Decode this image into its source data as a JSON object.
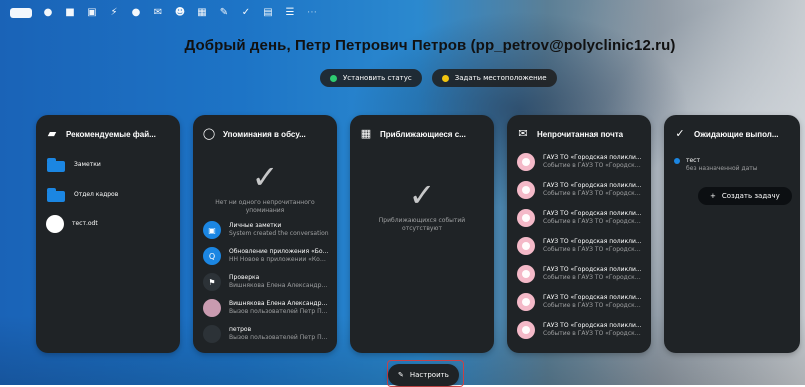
{
  "greeting": "Добрый день, Петр Петрович Петров (pp_petrov@polyclinic12.ru)",
  "actions": {
    "status_label": "Установить статус",
    "location_label": "Задать местоположение"
  },
  "colors": {
    "status_dot": "#2ecc71",
    "location_dot": "#f1c40f",
    "accent": "#1b86e2",
    "card_bg": "#1f2326"
  },
  "topbar": {
    "icons": [
      "logo",
      "dashboard-icon",
      "files-icon",
      "photos-icon",
      "activity-icon",
      "talk-icon",
      "mail-icon",
      "contacts-icon",
      "calendar-icon",
      "notes-icon",
      "tasks-icon",
      "deck-icon",
      "forms-icon",
      "more-icon"
    ]
  },
  "cards": {
    "recommended": {
      "title": "Рекомендуемые фай...",
      "icon": "folder-icon",
      "items": [
        {
          "label": "Заметки",
          "icon": "folder-icon"
        },
        {
          "label": "Отдел кадров",
          "icon": "folder-icon"
        },
        {
          "label": "тест.odt",
          "icon": "file-icon"
        }
      ]
    },
    "mentions": {
      "title": "Упоминания в обсу...",
      "empty_text": "Нет ни одного непрочитанного упоминания",
      "items": [
        {
          "title": "Личные заметки",
          "subtitle": "System created the conversation",
          "avatar_color": "#1b86e2",
          "avatar_text": "▣"
        },
        {
          "title": "Обновление приложения «Бо...",
          "subtitle": "НН Новое в приложении «Кон...",
          "avatar_color": "#1b86e2",
          "avatar_text": "Q"
        },
        {
          "title": "Проверка",
          "subtitle": "Вишнякова Елена Александро...",
          "avatar_color": "#2c3237",
          "avatar_text": "⚑"
        },
        {
          "title": "Вишнякова Елена Александро...",
          "subtitle": "Вызов пользователей Петр П...",
          "avatar_color": "#c99bb0",
          "avatar_text": ""
        },
        {
          "title": "петров",
          "subtitle": "Вызов пользователей Петр П...",
          "avatar_color": "#2c3237",
          "avatar_text": ""
        }
      ]
    },
    "upcoming": {
      "title": "Приближающиеся с...",
      "empty_text": "Приближающихся событий отсутствуют"
    },
    "mail": {
      "title": "Непрочитанная почта",
      "items": [
        {
          "from": "ГАУЗ ТО «Городская поликли...",
          "subject": "Событие в ГАУЗ ТО «Городска..."
        },
        {
          "from": "ГАУЗ ТО «Городская поликли...",
          "subject": "Событие в ГАУЗ ТО «Городска..."
        },
        {
          "from": "ГАУЗ ТО «Городская поликли...",
          "subject": "Событие в ГАУЗ ТО «Городска..."
        },
        {
          "from": "ГАУЗ ТО «Городская поликли...",
          "subject": "Событие в ГАУЗ ТО «Городска..."
        },
        {
          "from": "ГАУЗ ТО «Городская поликли...",
          "subject": "Событие в ГАУЗ ТО «Городска..."
        },
        {
          "from": "ГАУЗ ТО «Городская поликли...",
          "subject": "Событие в ГАУЗ ТО «Городска..."
        },
        {
          "from": "ГАУЗ ТО «Городская поликли...",
          "subject": "Событие в ГАУЗ ТО «Городска..."
        }
      ]
    },
    "tasks": {
      "title": "Ожидающие выпол...",
      "item_title": "тест",
      "item_subtitle": "без назначенной даты",
      "create_label": "Создать задачу"
    }
  },
  "footer": {
    "customize_label": "Настроить"
  }
}
